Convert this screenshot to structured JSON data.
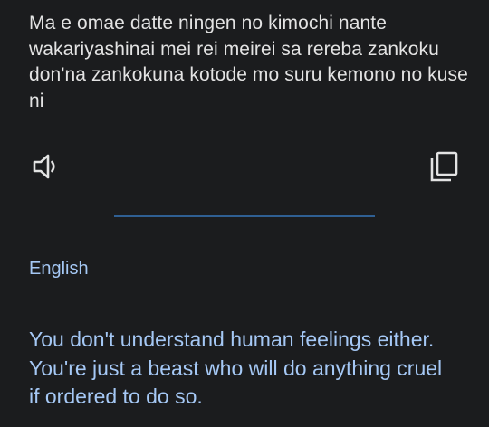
{
  "source": {
    "text": "Ma e omae datte ningen no kimochi nante wakariyashinai mei rei meirei sa rereba zankoku don'na zankokuna kotode mo suru kemono no kuse ni"
  },
  "controls": {
    "listen_icon": "speaker-icon",
    "copy_icon": "copy-icon"
  },
  "target": {
    "language": "English",
    "text": "You don't understand human feelings either. You're just a beast who will do anything cruel if ordered to do so."
  },
  "colors": {
    "background": "#1b1c1e",
    "source_text": "#e3e3e3",
    "accent": "#a5c8f5",
    "divider": "#2f5f93"
  }
}
